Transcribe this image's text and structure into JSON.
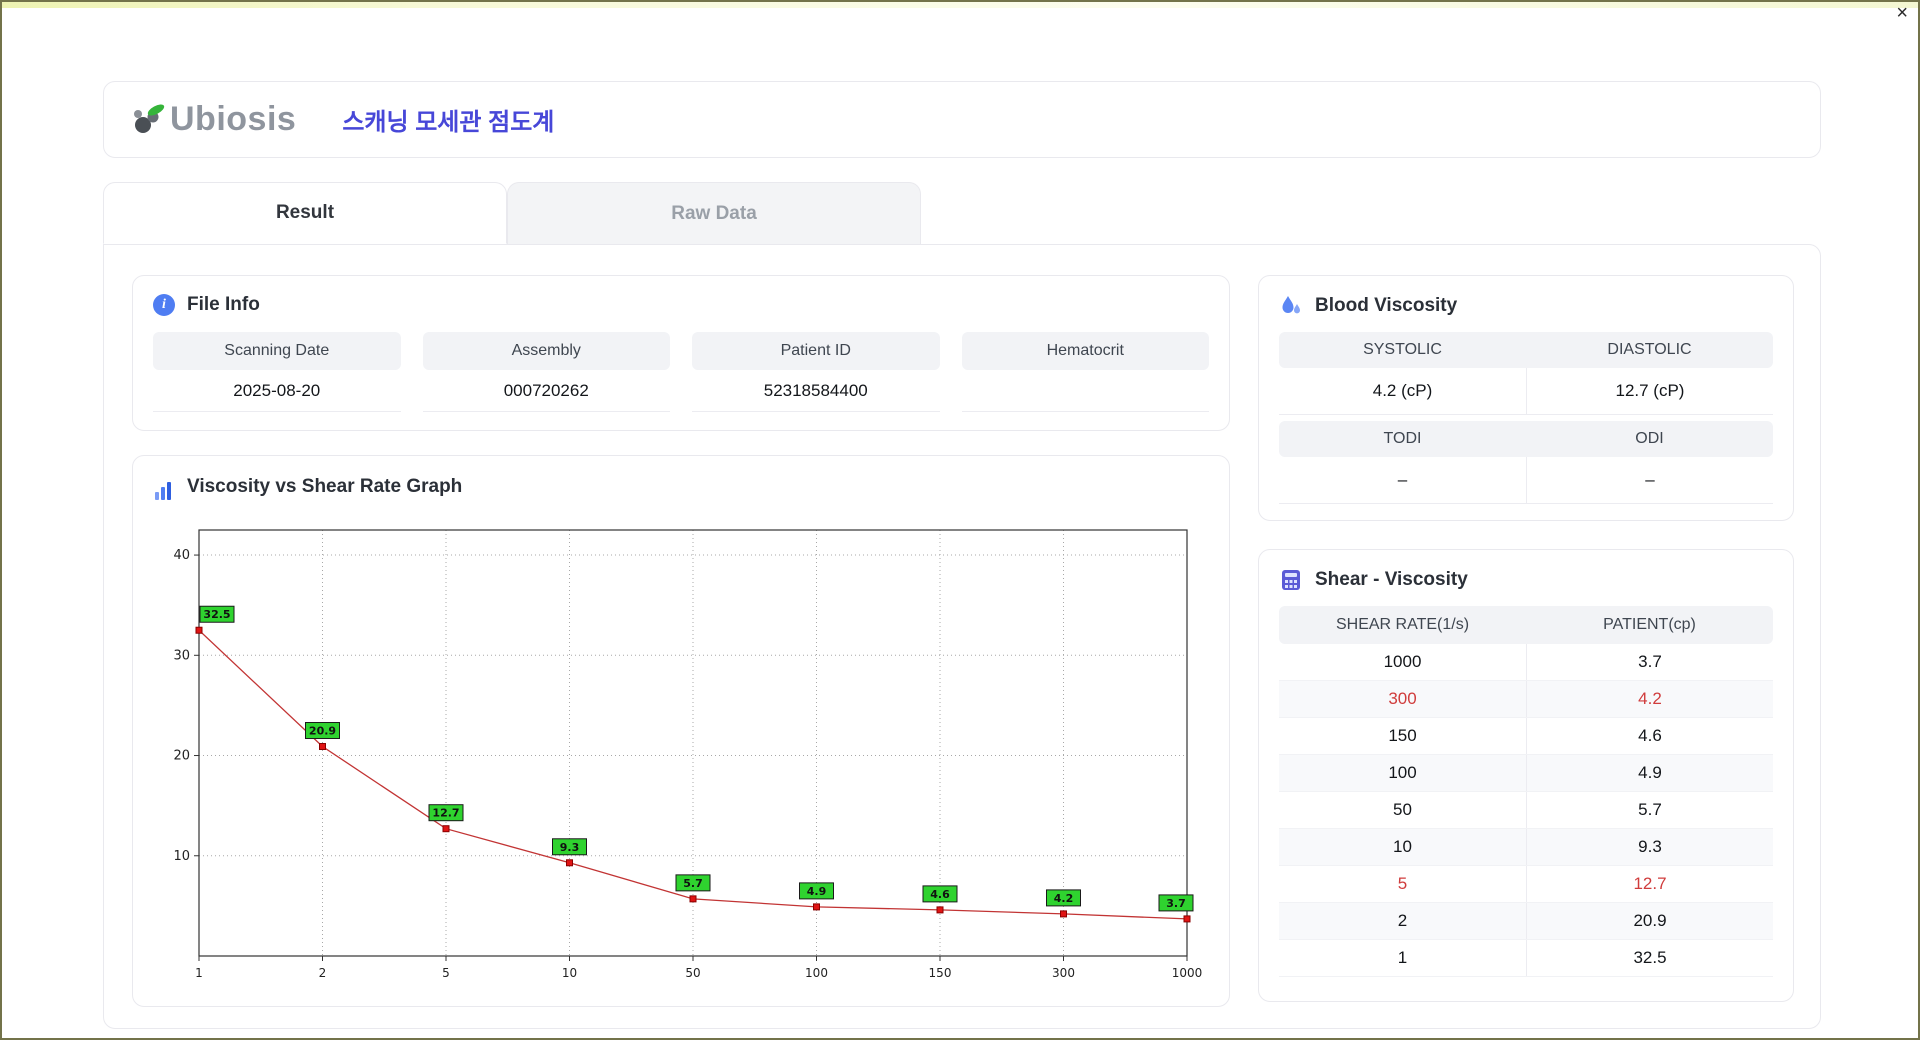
{
  "window": {
    "close_label": "×"
  },
  "header": {
    "logo_text": "Ubiosis",
    "app_title": "스캐닝 모세관 점도계"
  },
  "tabs": [
    {
      "label": "Result",
      "active": true
    },
    {
      "label": "Raw Data",
      "active": false
    }
  ],
  "file_info": {
    "title": "File Info",
    "fields": [
      {
        "label": "Scanning Date",
        "value": "2025-08-20"
      },
      {
        "label": "Assembly",
        "value": "000720262"
      },
      {
        "label": "Patient ID",
        "value": "52318584400"
      },
      {
        "label": "Hematocrit",
        "value": ""
      }
    ]
  },
  "blood_viscosity": {
    "title": "Blood Viscosity",
    "cells": [
      {
        "label": "SYSTOLIC",
        "value": "4.2 (cP)"
      },
      {
        "label": "DIASTOLIC",
        "value": "12.7 (cP)"
      },
      {
        "label": "TODI",
        "value": "–"
      },
      {
        "label": "ODI",
        "value": "–"
      }
    ]
  },
  "shear_viscosity": {
    "title": "Shear - Viscosity",
    "columns": [
      "SHEAR RATE(1/s)",
      "PATIENT(cp)"
    ],
    "rows": [
      {
        "shear_rate": "1000",
        "patient": "3.7",
        "highlight": false
      },
      {
        "shear_rate": "300",
        "patient": "4.2",
        "highlight": true
      },
      {
        "shear_rate": "150",
        "patient": "4.6",
        "highlight": false
      },
      {
        "shear_rate": "100",
        "patient": "4.9",
        "highlight": false
      },
      {
        "shear_rate": "50",
        "patient": "5.7",
        "highlight": false
      },
      {
        "shear_rate": "10",
        "patient": "9.3",
        "highlight": false
      },
      {
        "shear_rate": "5",
        "patient": "12.7",
        "highlight": true
      },
      {
        "shear_rate": "2",
        "patient": "20.9",
        "highlight": false
      },
      {
        "shear_rate": "1",
        "patient": "32.5",
        "highlight": false
      }
    ]
  },
  "chart_data": {
    "type": "line",
    "title": "Viscosity vs Shear Rate Graph",
    "x_categories": [
      1,
      2,
      5,
      10,
      50,
      100,
      150,
      300,
      1000
    ],
    "values": [
      32.5,
      20.9,
      12.7,
      9.3,
      5.7,
      4.9,
      4.6,
      4.2,
      3.7
    ],
    "xlabel": "",
    "ylabel": "",
    "ylim": [
      0,
      42.5
    ],
    "yticks": [
      10,
      20,
      30,
      40
    ],
    "x_scale": "categorical",
    "grid": "dotted",
    "legend": "none",
    "line_color": "#c23434",
    "marker_color": "#e01414",
    "marker_edge_color": "#8b0000",
    "label_bg": "#2fd32f",
    "label_border": "#1a1a1a"
  }
}
